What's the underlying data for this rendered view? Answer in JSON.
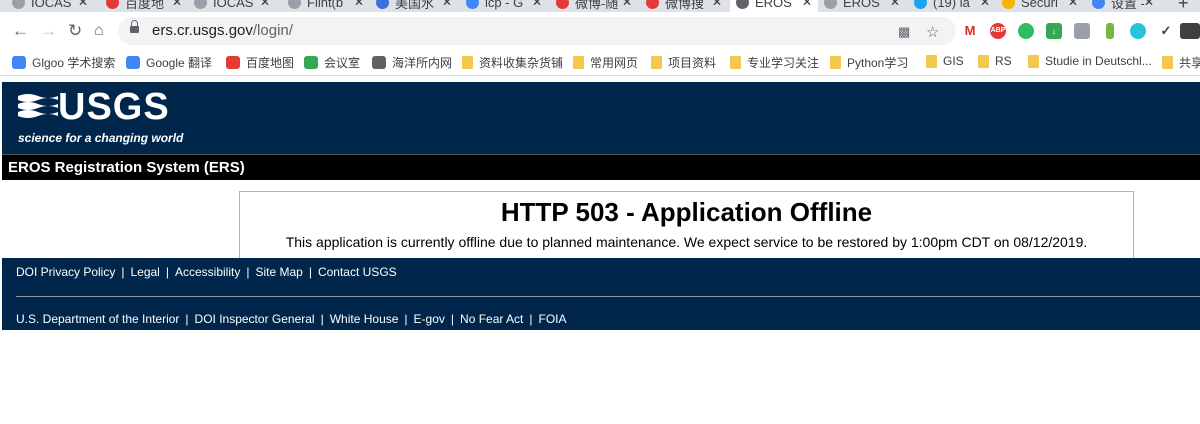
{
  "browser": {
    "tabs": [
      {
        "title": "IOCAS",
        "color": "#9aa0a6"
      },
      {
        "title": "百度地",
        "color": "#e53935"
      },
      {
        "title": "IOCAS",
        "color": "#9aa0a6"
      },
      {
        "title": "Flint(b",
        "color": "#9aa0a6"
      },
      {
        "title": "美国水",
        "color": "#3f6fd8"
      },
      {
        "title": "icp - G",
        "color": "#4285f4"
      },
      {
        "title": "微博-随",
        "color": "#e53935"
      },
      {
        "title": "微博搜",
        "color": "#e53935"
      },
      {
        "title": "EROS",
        "color": "#5f6368"
      },
      {
        "title": "EROS",
        "color": "#9aa0a6"
      },
      {
        "title": "(19) la",
        "color": "#1da1f2"
      },
      {
        "title": "Securi",
        "color": "#f4b400"
      },
      {
        "title": "设置 -",
        "color": "#4285f4"
      }
    ],
    "new_tab": "+",
    "url_host": "ers.cr.usgs.gov",
    "url_path": "/login/",
    "bookmarks": [
      {
        "label": "Glgoo 学术搜索",
        "type": "site"
      },
      {
        "label": "Google 翻译",
        "type": "site"
      },
      {
        "label": "百度地图",
        "type": "site"
      },
      {
        "label": "会议室",
        "type": "site"
      },
      {
        "label": "海洋所内网",
        "type": "site"
      },
      {
        "label": "资料收集杂货铺",
        "type": "folder"
      },
      {
        "label": "常用网页",
        "type": "folder"
      },
      {
        "label": "项目资料",
        "type": "folder"
      },
      {
        "label": "专业学习关注",
        "type": "folder"
      },
      {
        "label": "Python学习",
        "type": "folder"
      },
      {
        "label": "GIS",
        "type": "folder"
      },
      {
        "label": "RS",
        "type": "folder"
      },
      {
        "label": "Studie in Deutschl...",
        "type": "folder"
      },
      {
        "label": "共享",
        "type": "folder"
      }
    ],
    "extension_labels": {
      "mail": "M",
      "adblock": "ABP"
    }
  },
  "page": {
    "logo_text": "USGS",
    "logo_tagline": "science for a changing world",
    "system_title": "EROS Registration System (ERS)",
    "error_title": "HTTP 503 - Application Offline",
    "error_message": "This application is currently offline due to planned maintenance. We expect service to be restored by 1:00pm CDT on 08/12/2019.",
    "footer_links_1": [
      "DOI Privacy Policy",
      "Legal",
      "Accessibility",
      "Site Map",
      "Contact USGS"
    ],
    "footer_links_2": [
      "U.S. Department of the Interior",
      "DOI Inspector General",
      "White House",
      "E-gov",
      "No Fear Act",
      "FOIA"
    ],
    "separator": "|"
  },
  "colors": {
    "banner": "#00264c",
    "ers_bar": "#000000",
    "error_border": "#9fb6d4"
  }
}
